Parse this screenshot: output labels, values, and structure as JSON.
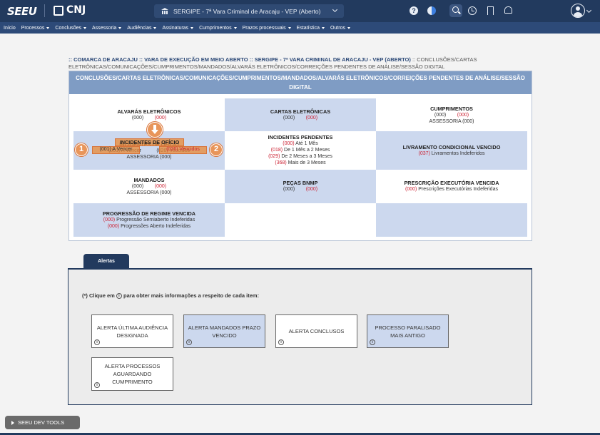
{
  "app": {
    "logo": "SEEU",
    "cnj": "CNJ",
    "court_selector": "SERGIPE - 7ª Vara Criminal de Aracaju - VEP (Aberto)"
  },
  "menu": [
    {
      "label": "Início",
      "dropdown": false
    },
    {
      "label": "Processos",
      "dropdown": true
    },
    {
      "label": "Conclusões",
      "dropdown": true
    },
    {
      "label": "Assessoria",
      "dropdown": true
    },
    {
      "label": "Audiências",
      "dropdown": true
    },
    {
      "label": "Assinaturas",
      "dropdown": true
    },
    {
      "label": "Cumprimentos",
      "dropdown": true
    },
    {
      "label": "Prazos processuais",
      "dropdown": true
    },
    {
      "label": "Estatística",
      "dropdown": true
    },
    {
      "label": "Outros",
      "dropdown": true
    }
  ],
  "breadcrumb": {
    "path": ":: COMARCA DE ARACAJU :: VARA DE EXECUÇÃO EM MEIO ABERTO :: SERGIPE - 7ª VARA CRIMINAL DE ARACAJU - VEP (ABERTO)",
    "tail": ":: CONCLUSÕES/CARTAS ELETRÔNICAS/COMUNICAÇÕES/CUMPRIMENTOS/MANDADOS/ALVARÁS ELETRÔNICOS/CORREIÇÕES PENDENTES DE ANÁLISE/SESSÃO DIGITAL"
  },
  "panel": {
    "header": "CONCLUSÕES/CARTAS ELETRÔNICAS/COMUNICAÇÕES/CUMPRIMENTOS/MANDADOS/ALVARÁS ELETRÔNICOS/CORREIÇÕES PENDENTES DE ANÁLISE/SESSÃO DIGITAL",
    "alvaras": {
      "title": "ALVARÁS ELETRÔNICOS",
      "c1": "(000)",
      "c2": "(000)"
    },
    "cartas": {
      "title": "CARTAS ELETRÔNICAS",
      "c1": "(000)",
      "c2": "(000)"
    },
    "cumprimentos": {
      "title": "CUMPRIMENTOS",
      "c1": "(000)",
      "c2": "(000)",
      "sub": "ASSESSORIA (000)"
    },
    "incidentes_oficio": {
      "title": "INCIDENTES DE OFÍCIO",
      "a_vencer": "(001) A Vencer",
      "vencidos": "(026) Vencidos",
      "sub": "ASSESSORIA (000)"
    },
    "incidentes_pendentes": {
      "title": "INCIDENTES PENDENTES",
      "rows": [
        {
          "count": "(000)",
          "label": " Até 1 Mês"
        },
        {
          "count": "(018)",
          "label": " De 1 Mês a 2 Meses"
        },
        {
          "count": "(029)",
          "label": " De 2 Meses a 3 Meses"
        },
        {
          "count": "(368)",
          "label": " Mais de 3 Meses"
        }
      ]
    },
    "livramento": {
      "title": "LIVRAMENTO CONDICIONAL VENCIDO",
      "count": "(037)",
      "label": " Livramentos Indeferidos"
    },
    "mandados": {
      "title": "MANDADOS",
      "c1": "(000)",
      "c2": "(000)",
      "sub": "ASSESSORIA (000)"
    },
    "pecas": {
      "title": "PEÇAS BNMP",
      "c1": "(000)",
      "c2": "(000)"
    },
    "prescricao": {
      "title": "PRESCRIÇÃO EXECUTÓRIA VENCIDA",
      "count": "(000)",
      "label": " Prescrições Executórias Indeferidas"
    },
    "progressao": {
      "title": "PROGRESSÃO DE REGIME VENCIDA",
      "r1_count": "(000)",
      "r1_label": " Progressão Semiaberto Indeferidas",
      "r2_count": "(000)",
      "r2_label": " Progressões Aberto Indeferidas"
    },
    "markers": {
      "one": "1",
      "two": "2"
    }
  },
  "alertas": {
    "tab": "Alertas",
    "note_prefix": "(*) Clique em",
    "note_suffix": "para obter mais informações a respeito de cada item:",
    "info_glyph": "i",
    "boxes": [
      {
        "label": "ALERTA ÚLTIMA AUDIÊNCIA DESIGNADA"
      },
      {
        "label": "ALERTA MANDADOS PRAZO VENCIDO"
      },
      {
        "label": "ALERTA CONCLUSOS"
      },
      {
        "label": "PROCESSO PARALISADO MAIS ANTIGO"
      },
      {
        "label": "ALERTA PROCESSOS AGUARDANDO CUMPRIMENTO"
      }
    ]
  },
  "devtools": {
    "label": "SEEU DEV TOOLS"
  },
  "colors": {
    "topbar": "#223a5e",
    "menubar": "#2d4a78",
    "panel_head": "#7f9cc4",
    "cell_blue": "#ccd8ee",
    "count_red": "#cc2233",
    "highlight": "#e8955a"
  },
  "icons": [
    "bank-icon",
    "help-icon",
    "contrast-icon",
    "search-icon",
    "history-icon",
    "bookmark-icon",
    "bell-icon",
    "user-avatar-icon",
    "info-icon",
    "arrow-down-icon",
    "play-icon"
  ]
}
